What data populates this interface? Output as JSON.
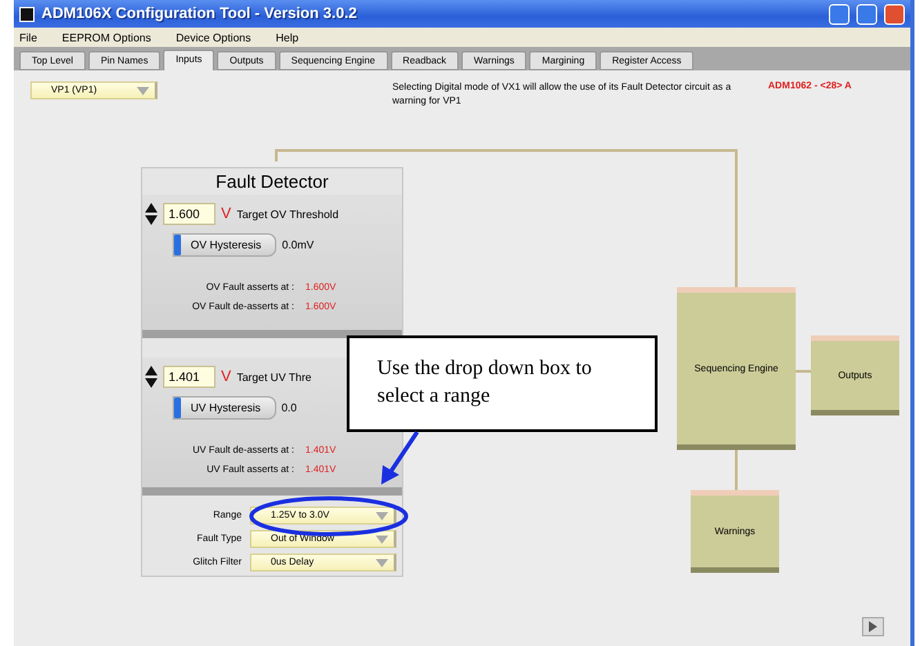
{
  "window": {
    "title": "ADM106X Configuration Tool -  Version 3.0.2"
  },
  "menu": [
    "File",
    "EEPROM Options",
    "Device Options",
    "Help"
  ],
  "tabs": [
    {
      "label": "Top Level",
      "selected": false
    },
    {
      "label": "Pin Names",
      "selected": false
    },
    {
      "label": "Inputs",
      "selected": true
    },
    {
      "label": "Outputs",
      "selected": false
    },
    {
      "label": "Sequencing Engine",
      "selected": false
    },
    {
      "label": "Readback",
      "selected": false
    },
    {
      "label": "Warnings",
      "selected": false
    },
    {
      "label": "Margining",
      "selected": false
    },
    {
      "label": "Register Access",
      "selected": false
    }
  ],
  "channel_select": {
    "value": "VP1  (VP1)"
  },
  "info_text": "Selecting Digital mode of VX1 will allow the use of its Fault Detector circuit as a warning for VP1",
  "device_label": "ADM1062 - <28> A",
  "fault_detector": {
    "title": "Fault Detector",
    "sections": [
      {
        "value": "1.600",
        "unit": "V",
        "label": "Target OV Threshold",
        "hysteresis": {
          "label": "OV Hysteresis",
          "level": 0
        },
        "hysteresis_reading": "0.0mV",
        "readings": [
          {
            "label": "OV Fault asserts at :",
            "value": "1.600V"
          },
          {
            "label": "OV Fault de-asserts at :",
            "value": "1.600V"
          }
        ]
      },
      {
        "value": "1.401",
        "unit": "V",
        "label": "Target UV Thre",
        "hysteresis": {
          "label": "UV Hysteresis",
          "level": 0
        },
        "hysteresis_reading": "0.0",
        "readings": [
          {
            "label": "UV Fault de-asserts at :",
            "value": "1.401V"
          },
          {
            "label": "UV Fault asserts at :",
            "value": "1.401V"
          }
        ]
      }
    ],
    "settings": [
      {
        "label": "Range",
        "value": "1.25V to 3.0V"
      },
      {
        "label": "Fault Type",
        "value": "Out of Window"
      },
      {
        "label": "Glitch Filter",
        "value": "0us Delay"
      }
    ]
  },
  "diagram": {
    "blocks": [
      "Sequencing Engine",
      "Outputs",
      "Warnings"
    ]
  },
  "callout": {
    "text": "Use the drop down box to select a range"
  }
}
